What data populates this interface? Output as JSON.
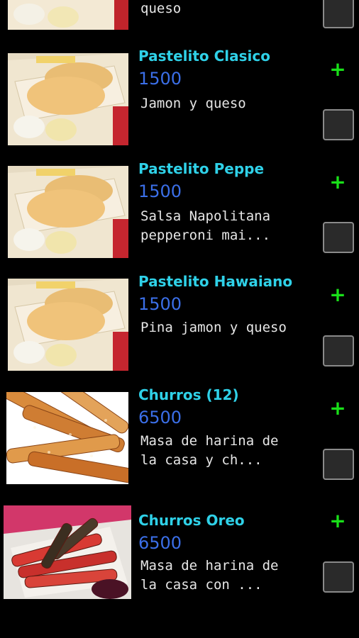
{
  "items": [
    {
      "name": "",
      "price": "",
      "description": "queso",
      "thumb": "pastelito"
    },
    {
      "name": "Pastelito Clasico",
      "price": "1500",
      "description": "Jamon y queso",
      "thumb": "pastelito"
    },
    {
      "name": "Pastelito Peppe",
      "price": "1500",
      "description": "Salsa Napolitana\npepperoni mai...",
      "thumb": "pastelito"
    },
    {
      "name": "Pastelito Hawaiano",
      "price": "1500",
      "description": "Pina jamon y queso",
      "thumb": "pastelito"
    },
    {
      "name": "Churros (12)",
      "price": "6500",
      "description": "Masa de harina de\nla casa y ch...",
      "thumb": "churros"
    },
    {
      "name": "Churros Oreo",
      "price": "6500",
      "description": "Masa de harina de\nla casa con ...",
      "thumb": "churros-oreo"
    }
  ],
  "add_label": "+",
  "colors": {
    "name": "#2fd1e8",
    "price": "#3b6fe8",
    "add": "#19e019",
    "background": "#000000"
  }
}
